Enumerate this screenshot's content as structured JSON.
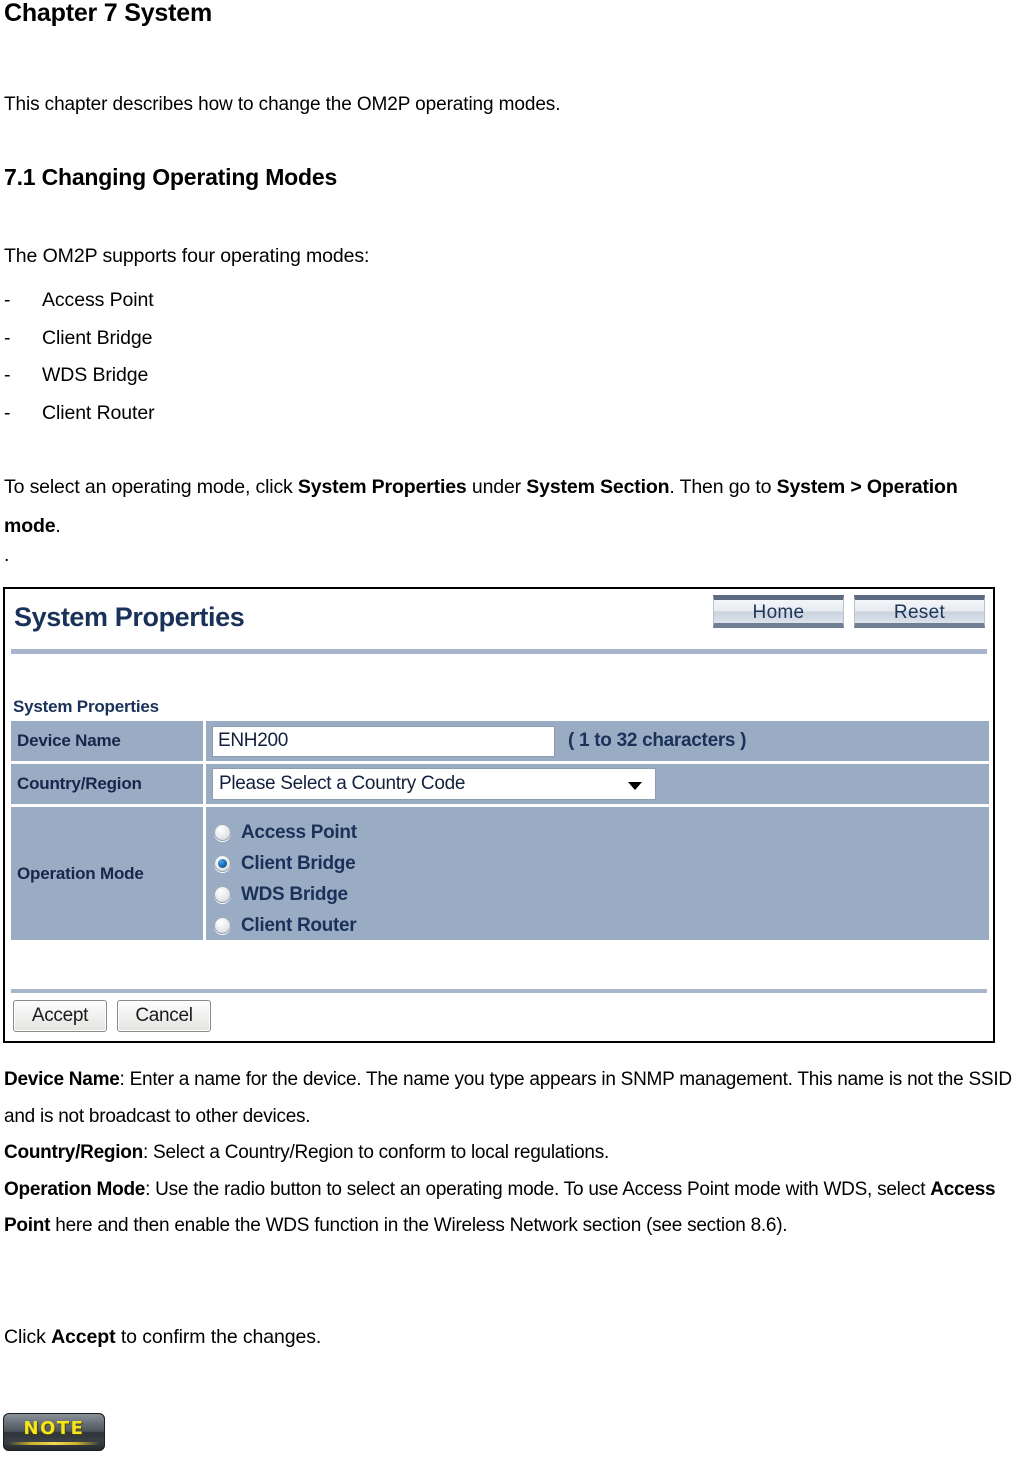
{
  "document": {
    "chapter_title": "Chapter 7 System",
    "intro": "This chapter describes how to change the OM2P operating modes.",
    "section_title": "7.1 Changing Operating Modes",
    "modes_intro": "The OM2P supports four operating modes:",
    "modes": [
      "Access Point",
      "Client Bridge",
      "WDS Bridge",
      "Client Router"
    ],
    "dash_marker": "-",
    "select_paragraph": {
      "part1": "To select an operating mode, click ",
      "bold1": "System Properties",
      "part2": " under ",
      "bold2": "System Section",
      "part3": ". Then go to ",
      "bold3": "System > Operation mode",
      "part4": "."
    },
    "stray_dot": ".",
    "descriptions": {
      "device_name_label": "Device Name",
      "device_name_text": ": Enter a name for the device. The name you type appears in SNMP management. This name is not the SSID and is not broadcast to other devices.",
      "country_region_label": "Country/Region",
      "country_region_text": ": Select a Country/Region to conform to local regulations.",
      "operation_mode_label": "Operation Mode",
      "operation_mode_text_1": ": Use the radio button to select an operating mode. To use Access Point mode with WDS, select ",
      "operation_mode_bold": "Access Point",
      "operation_mode_text_2": " here and then enable the WDS function in the Wireless Network section (see section 8.6)."
    },
    "click_accept": {
      "part1": "Click ",
      "bold": "Accept",
      "part2": " to confirm the changes."
    },
    "note_badge": "NOTE"
  },
  "screenshot": {
    "header": {
      "title": "System Properties",
      "buttons": [
        {
          "label": "Home",
          "name": "home-button"
        },
        {
          "label": "Reset",
          "name": "reset-button"
        }
      ]
    },
    "section_label": "System Properties",
    "rows": {
      "device_name": {
        "label": "Device Name",
        "value": "ENH200",
        "hint": "( 1 to 32 characters )"
      },
      "country_region": {
        "label": "Country/Region",
        "selected": "Please Select a Country Code"
      },
      "operation_mode": {
        "label": "Operation Mode",
        "options": [
          {
            "label": "Access Point",
            "checked": false
          },
          {
            "label": "Client Bridge",
            "checked": true
          },
          {
            "label": "WDS Bridge",
            "checked": false
          },
          {
            "label": "Client Router",
            "checked": false
          }
        ]
      }
    },
    "actions": [
      {
        "label": "Accept",
        "name": "accept-button"
      },
      {
        "label": "Cancel",
        "name": "cancel-button"
      }
    ],
    "colors": {
      "row_background": "#9aabc4",
      "header_text": "#1a3259",
      "rule": "#a7b6cd",
      "radio_checked": "#1361a8"
    }
  }
}
